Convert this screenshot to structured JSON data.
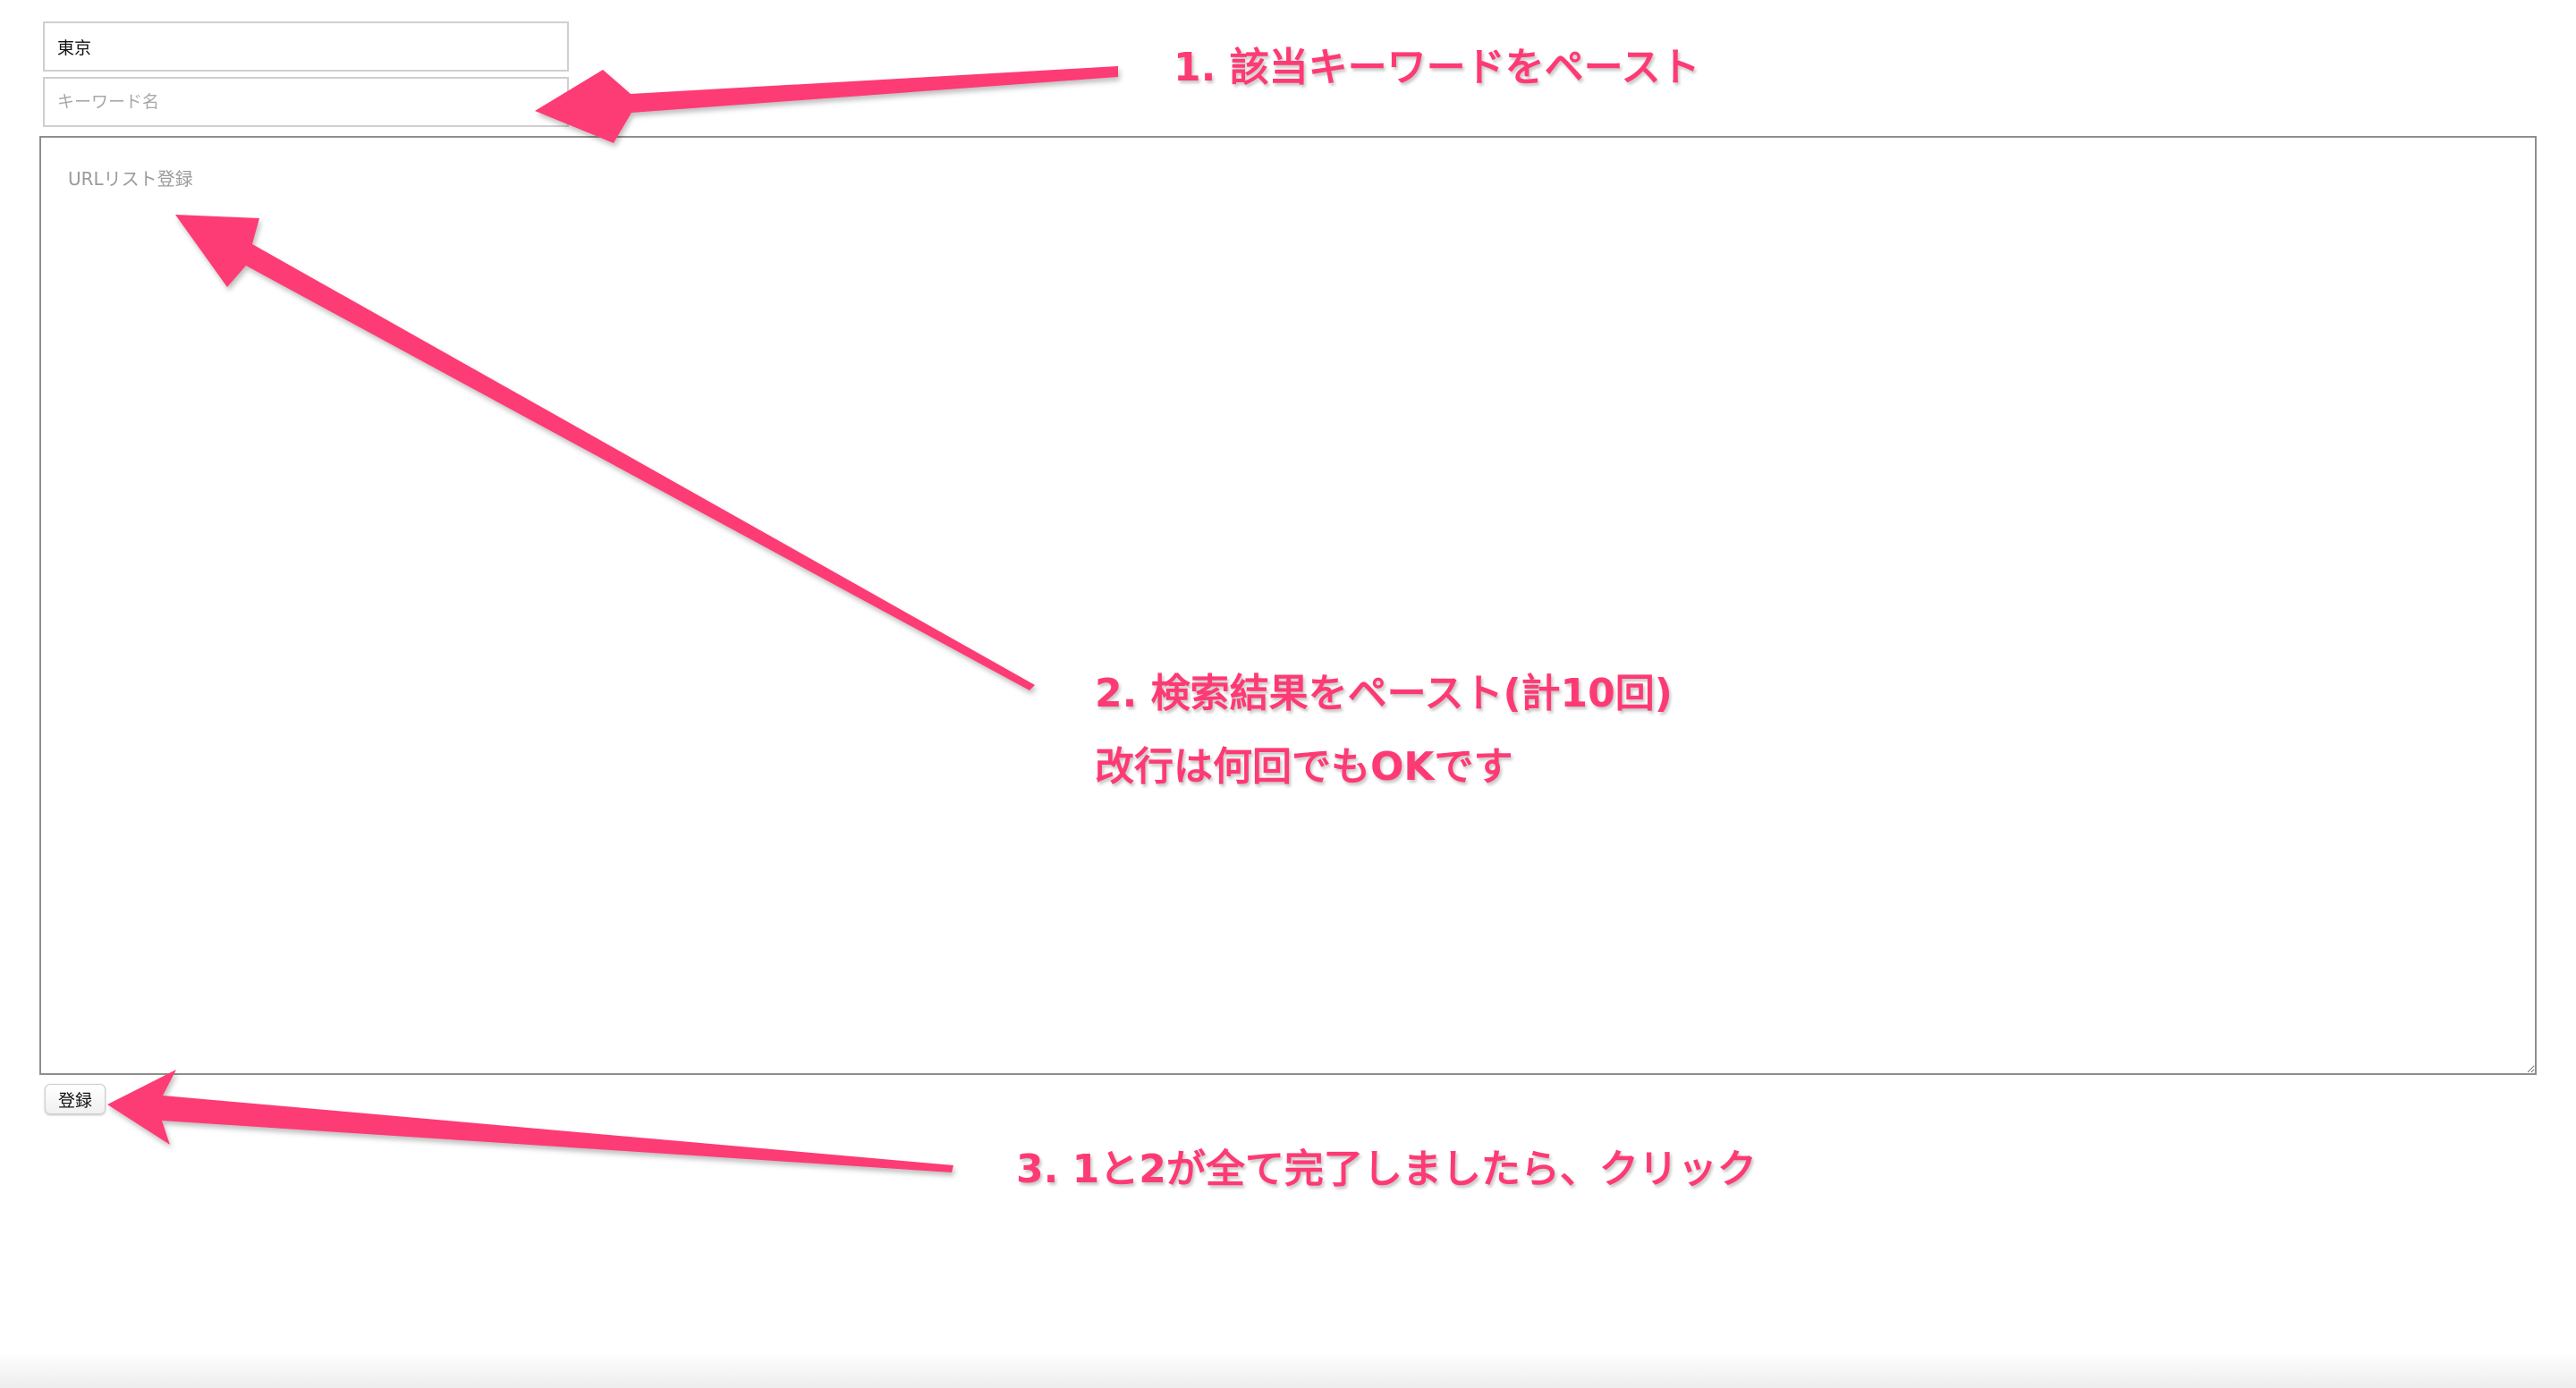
{
  "form": {
    "keyword_value": "東京",
    "keyword_placeholder": "キーワード名",
    "url_list_placeholder": "URLリスト登録",
    "submit_label": "登録"
  },
  "annotations": {
    "step1": "1. 該当キーワードをペースト",
    "step2_line1": "2. 検索結果をペースト(計10回)",
    "step2_line2": "改行は何回でもOKです",
    "step3": "3. 1と2が全て完了しましたら、クリック"
  },
  "colors": {
    "annotation": "#fd3a74"
  }
}
